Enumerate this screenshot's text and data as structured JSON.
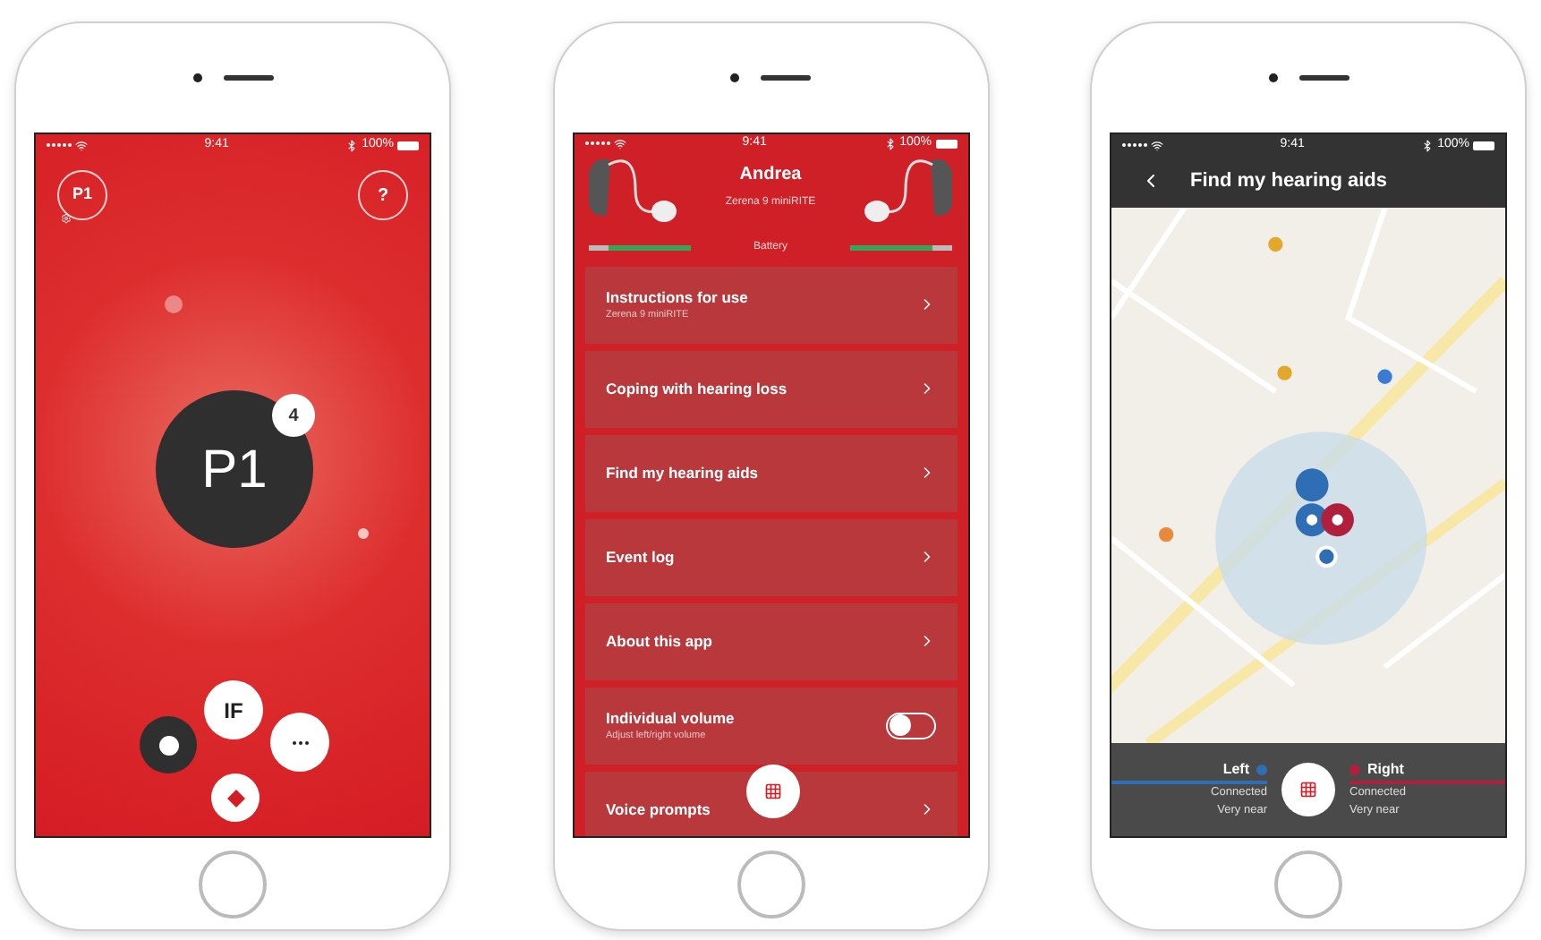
{
  "phones": [
    {
      "kind": "home",
      "status_bar": {
        "time": "9:41",
        "battery": "100%"
      },
      "program_button": "P1",
      "help_button": "?",
      "program": {
        "label": "P1",
        "count": "4"
      },
      "if_button": "IF"
    },
    {
      "kind": "menu",
      "status_bar": {
        "time": "9:41",
        "battery": "100%"
      },
      "user": "Andrea",
      "model": "Zerena 9 miniRITE",
      "battery": {
        "label": "Battery",
        "left": {
          "level": 0.8
        },
        "right": {
          "level": 0.8
        }
      },
      "items": [
        {
          "kind": "link",
          "title": "Instructions for use",
          "subtitle": "Zerena 9 miniRITE"
        },
        {
          "kind": "link",
          "title": "Coping with hearing loss"
        },
        {
          "kind": "link",
          "title": "Find my hearing aids"
        },
        {
          "kind": "link",
          "title": "Event log"
        },
        {
          "kind": "link",
          "title": "About this app"
        },
        {
          "kind": "toggle",
          "title": "Individual volume",
          "subtitle": "Adjust left/right volume",
          "on": false
        },
        {
          "kind": "link",
          "title": "Voice prompts"
        }
      ]
    },
    {
      "kind": "map",
      "status_bar": {
        "time": "9:41",
        "battery": "100%"
      },
      "title": "Find my hearing aids",
      "sides": [
        {
          "label": "Left",
          "color": "#2f6db5",
          "status": "Connected",
          "distance": "Very near"
        },
        {
          "label": "Right",
          "color": "#b0203c",
          "status": "Connected",
          "distance": "Very near"
        }
      ]
    }
  ]
}
